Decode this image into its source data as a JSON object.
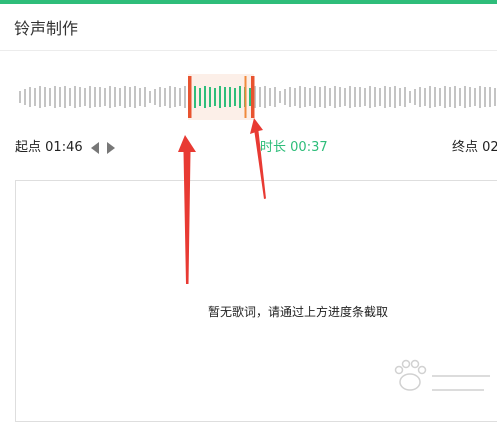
{
  "app": {
    "title": "铃声制作",
    "accent_color": "#2ebd7a"
  },
  "selection": {
    "start_label": "起点",
    "start_time": "01:46",
    "duration_label": "时长",
    "duration_time": "00:37",
    "end_label": "终点",
    "end_time": "02"
  },
  "icons": {
    "prev": "triangle-left-icon",
    "next": "triangle-right-icon"
  },
  "lyrics": {
    "empty_message": "暂无歌词，请通过上方进度条截取"
  },
  "colors": {
    "wave_inactive": "#c4c4c4",
    "wave_active": "#2ebd7a",
    "handle": "#e8532f",
    "selection_bg": "#fcefe8",
    "annotation": "#e83a33"
  }
}
